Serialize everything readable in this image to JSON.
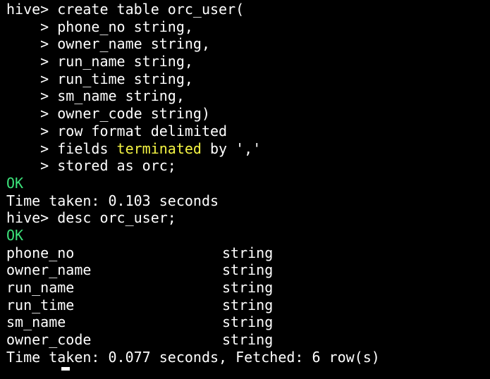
{
  "colors": {
    "background": "#000000",
    "text": "#ffffff",
    "ok": "#3ce27a",
    "keyword": "#f5f543"
  },
  "session": {
    "create": {
      "prompt": "hive> ",
      "command": "create table orc_user(",
      "continuation_prompt": "    > ",
      "lines": [
        "phone_no string,",
        "owner_name string,",
        "run_name string,",
        "run_time string,",
        "sm_name string,",
        "owner_code string)",
        "row format delimited"
      ],
      "fields_pre": "fields ",
      "fields_keyword": "terminated",
      "fields_post": " by ','",
      "last_line": "stored as orc;",
      "ok": "OK",
      "time_taken": "Time taken: 0.103 seconds"
    },
    "desc": {
      "prompt": "hive> ",
      "command": "desc orc_user;",
      "ok": "OK",
      "rows": [
        {
          "col": "phone_no",
          "type": "string"
        },
        {
          "col": "owner_name",
          "type": "string"
        },
        {
          "col": "run_name",
          "type": "string"
        },
        {
          "col": "run_time",
          "type": "string"
        },
        {
          "col": "sm_name",
          "type": "string"
        },
        {
          "col": "owner_code",
          "type": "string"
        }
      ],
      "time_taken": "Time taken: 0.077 seconds, Fetched: 6 row(s)"
    }
  }
}
